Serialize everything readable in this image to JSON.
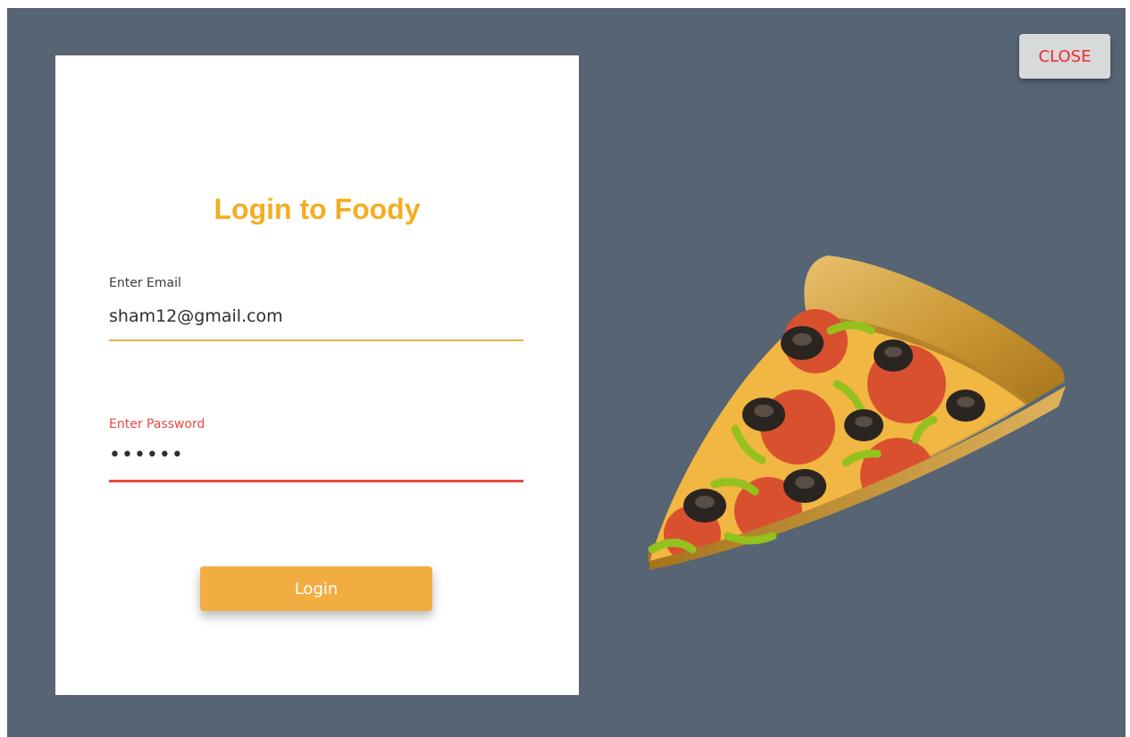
{
  "login_form": {
    "title": "Login to Foody",
    "email": {
      "label": "Enter Email",
      "value": "sham12@gmail.com"
    },
    "password": {
      "label": "Enter Password",
      "value": "••••••"
    },
    "submit_label": "Login"
  },
  "dialog": {
    "close_label": "CLOSE"
  },
  "illustration": {
    "icon": "pizza-slice-icon"
  },
  "colors": {
    "backdrop": "#566474",
    "brand": "#f5ad22",
    "button": "#f2ad42",
    "error": "#e54b40",
    "close_text": "#e82c34"
  }
}
